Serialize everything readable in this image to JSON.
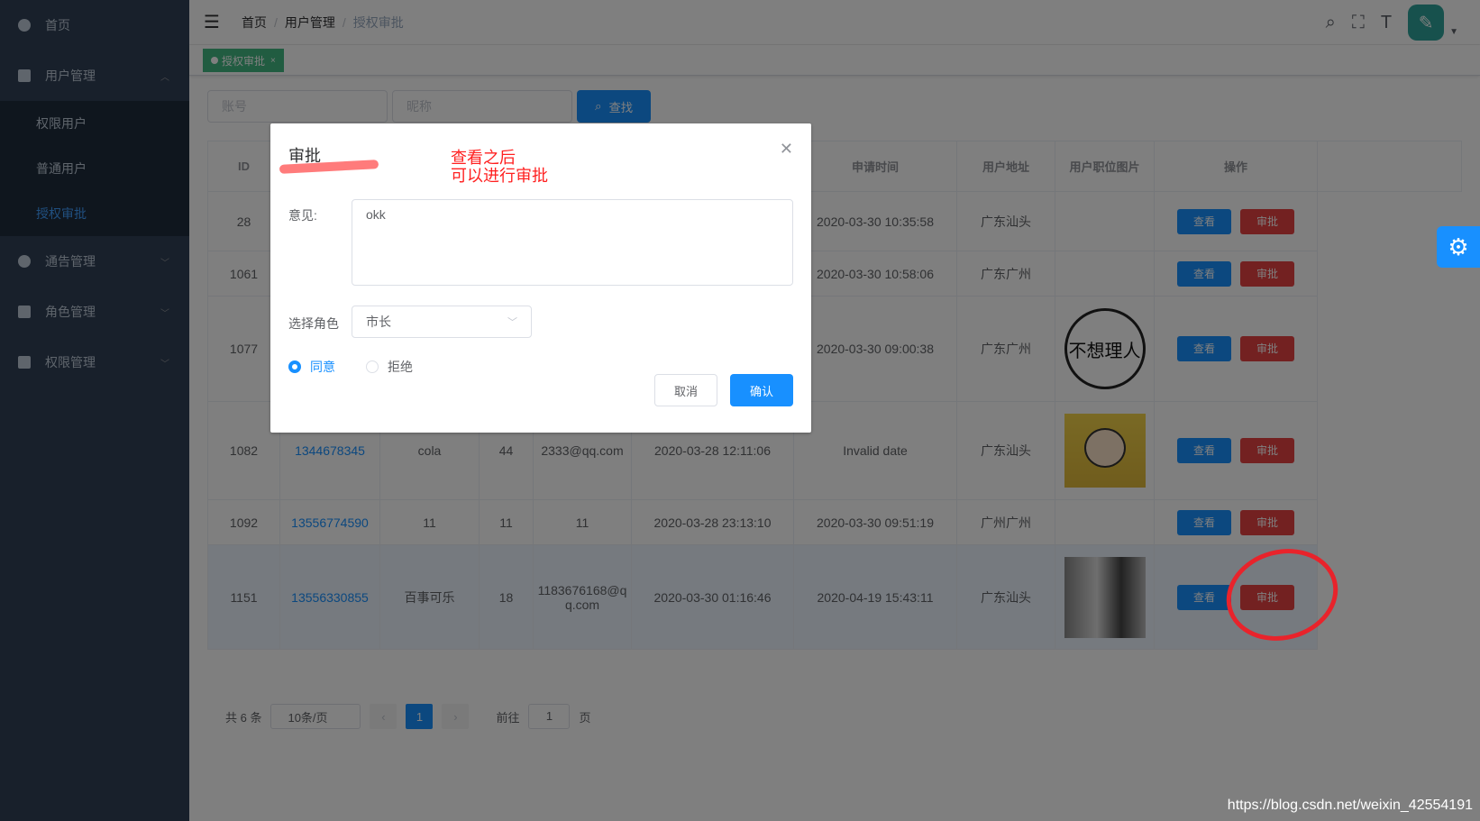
{
  "sidebar": {
    "items": [
      {
        "label": "首页",
        "icon": "dashboard-icon"
      },
      {
        "label": "用户管理",
        "icon": "grid-icon",
        "expanded": true,
        "children": [
          {
            "label": "权限用户"
          },
          {
            "label": "普通用户"
          },
          {
            "label": "授权审批",
            "active": true
          }
        ]
      },
      {
        "label": "通告管理",
        "icon": "circle-icon"
      },
      {
        "label": "角色管理",
        "icon": "grid-icon"
      },
      {
        "label": "权限管理",
        "icon": "grid-icon"
      }
    ]
  },
  "navbar": {
    "breadcrumb": [
      "首页",
      "用户管理",
      "授权审批"
    ]
  },
  "tags": [
    {
      "label": "授权审批"
    }
  ],
  "filters": {
    "account_placeholder": "账号",
    "nickname_placeholder": "昵称",
    "search_label": "查找"
  },
  "table": {
    "headers": [
      "ID",
      "",
      "",
      "",
      "",
      "",
      "申请时间",
      "用户地址",
      "用户职位图片",
      "操作"
    ],
    "rows": [
      {
        "id": "28",
        "account": "",
        "nickname": "",
        "age": "",
        "email": "",
        "created": "",
        "applied": "2020-03-30 10:35:58",
        "address": "广东汕头",
        "picture": ""
      },
      {
        "id": "1061",
        "account": "",
        "nickname": "",
        "age": "",
        "email": "",
        "created": "",
        "applied": "2020-03-30 10:58:06",
        "address": "广东广州",
        "picture": ""
      },
      {
        "id": "1077",
        "account": "",
        "nickname": "",
        "age": "",
        "email": "",
        "created": "",
        "applied": "2020-03-30 09:00:38",
        "address": "广东广州",
        "picture": "不想理人"
      },
      {
        "id": "1082",
        "account": "1344678345",
        "nickname": "cola",
        "age": "44",
        "email": "2333@qq.com",
        "created": "2020-03-28 12:11:06",
        "applied": "Invalid date",
        "address": "广东汕头",
        "picture": "cartoon"
      },
      {
        "id": "1092",
        "account": "13556774590",
        "nickname": "11",
        "age": "11",
        "email": "11",
        "created": "2020-03-28 23:13:10",
        "applied": "2020-03-30 09:51:19",
        "address": "广州广州",
        "picture": ""
      },
      {
        "id": "1151",
        "account": "13556330855",
        "nickname": "百事可乐",
        "age": "18",
        "email": "1183676168@qq.com",
        "created": "2020-03-30 01:16:46",
        "applied": "2020-04-19 15:43:11",
        "address": "广东汕头",
        "picture": "photo"
      }
    ],
    "view_label": "查看",
    "approve_label": "审批"
  },
  "pagination": {
    "total": "共 6 条",
    "page_size": "10条/页",
    "current": "1",
    "goto_prefix": "前往",
    "goto_value": "1",
    "goto_suffix": "页"
  },
  "modal": {
    "title": "审批",
    "opinion_label": "意见:",
    "opinion_value": "okk",
    "role_label": "选择角色",
    "role_value": "市长",
    "agree": "同意",
    "reject": "拒绝",
    "selected": "同意",
    "cancel": "取消",
    "confirm": "确认"
  },
  "annotation": {
    "line1": "查看之后",
    "line2": "可以进行审批"
  },
  "watermark": "https://blog.csdn.net/weixin_42554191",
  "colors": {
    "primary": "#1890ff",
    "danger": "#e64242",
    "sidebar": "#304156",
    "tag": "#42b983",
    "annotation": "#ff2020"
  }
}
